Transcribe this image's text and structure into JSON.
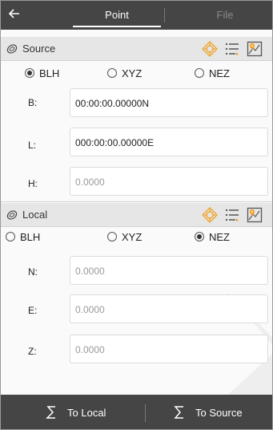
{
  "header": {
    "back_icon": "arrow-left-icon",
    "tabs": [
      {
        "label": "Point",
        "active": true
      },
      {
        "label": "File",
        "active": false
      }
    ]
  },
  "source": {
    "title": "Source",
    "icons": [
      "gps-target-icon",
      "list-icon",
      "map-pin-icon"
    ],
    "radios": [
      {
        "label": "BLH",
        "selected": true
      },
      {
        "label": "XYZ",
        "selected": false
      },
      {
        "label": "NEZ",
        "selected": false
      }
    ],
    "fields": [
      {
        "label": "B:",
        "value": "00:00:00.00000N",
        "placeholder": ""
      },
      {
        "label": "L:",
        "value": "000:00:00.00000E",
        "placeholder": ""
      },
      {
        "label": "H:",
        "value": "",
        "placeholder": "0.0000"
      }
    ]
  },
  "local": {
    "title": "Local",
    "icons": [
      "gps-target-icon",
      "list-icon",
      "map-pin-icon"
    ],
    "radios": [
      {
        "label": "BLH",
        "selected": false
      },
      {
        "label": "XYZ",
        "selected": false
      },
      {
        "label": "NEZ",
        "selected": true
      }
    ],
    "fields": [
      {
        "label": "N:",
        "value": "",
        "placeholder": "0.0000"
      },
      {
        "label": "E:",
        "value": "",
        "placeholder": "0.0000"
      },
      {
        "label": "Z:",
        "value": "",
        "placeholder": "0.0000"
      }
    ]
  },
  "footer": {
    "to_local": "To Local",
    "to_source": "To Source",
    "to_local_icon": "sum-icon",
    "to_source_icon": "sigma-icon"
  },
  "colors": {
    "bar_bg": "#454545",
    "section_bg": "#e6e6e6",
    "target_orange": "#f0a020"
  }
}
